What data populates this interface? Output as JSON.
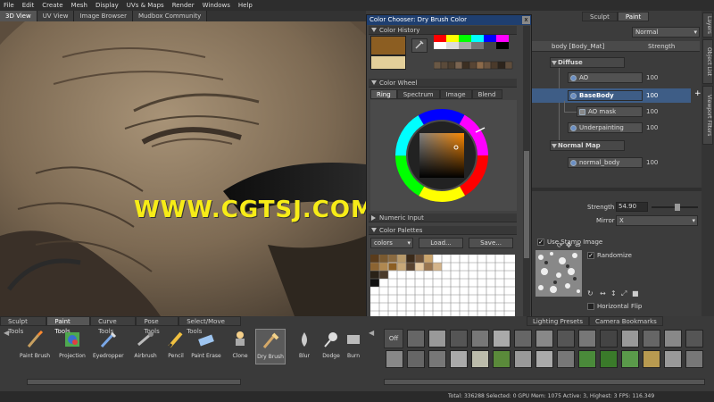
{
  "menu": [
    "File",
    "Edit",
    "Create",
    "Mesh",
    "Display",
    "UVs & Maps",
    "Render",
    "Windows",
    "Help"
  ],
  "view_tabs": [
    "3D View",
    "UV View",
    "Image Browser",
    "Mudbox Community"
  ],
  "watermark": "WWW.CGTSJ.COM",
  "dialog": {
    "title": "Color Chooser: Dry Brush Color",
    "close": "x",
    "history": "Color History",
    "wheel": "Color Wheel",
    "wheel_tabs": [
      "Ring",
      "Spectrum",
      "Image",
      "Blend"
    ],
    "numeric": "Numeric Input",
    "palettes": "Color Palettes",
    "palette_select": "colors",
    "load": "Load...",
    "save": "Save..."
  },
  "right": {
    "tabs": [
      "Sculpt",
      "Paint"
    ],
    "blend_mode": "Normal",
    "header_name": "body [Body_Mat]",
    "header_col": "Strength",
    "groups": [
      {
        "name": "Diffuse",
        "layers": [
          {
            "name": "AO",
            "value": "100"
          },
          {
            "name": "BaseBody",
            "value": "100"
          },
          {
            "name": "AO mask",
            "value": "100"
          },
          {
            "name": "Underpainting",
            "value": "100"
          }
        ]
      },
      {
        "name": "Normal Map",
        "layers": [
          {
            "name": "normal_body",
            "value": "100"
          }
        ]
      }
    ],
    "strength_label": "Strength",
    "strength_value": "54.90",
    "mirror_label": "Mirror",
    "mirror_value": "X",
    "use_stamp": "Use Stamp Image",
    "randomize": "Randomize",
    "hflip": "Horizontal Flip",
    "side_tabs": [
      "Layers",
      "Object List",
      "Viewport Filters"
    ]
  },
  "tools": {
    "tabs": [
      "Sculpt Tools",
      "Paint Tools",
      "Curve Tools",
      "Pose Tools",
      "Select/Move Tools"
    ],
    "items": [
      "Paint Brush",
      "Projection",
      "Eyedropper",
      "Airbrush",
      "Pencil",
      "Paint Erase",
      "Clone",
      "Dry Brush",
      "Blur",
      "Dodge",
      "Burn"
    ],
    "stamp_tabs": [
      "Lighting Presets",
      "Camera Bookmarks"
    ],
    "stamp_off": "Off"
  },
  "status": "Total: 336288  Selected: 0  GPU Mem: 1075  Active: 3, Highest: 3  FPS: 116.349",
  "colors": {
    "selection": "#3e5d86",
    "title": "#1f3f70",
    "watermark": "#f7ec17",
    "current_color": "#8c5e22"
  }
}
